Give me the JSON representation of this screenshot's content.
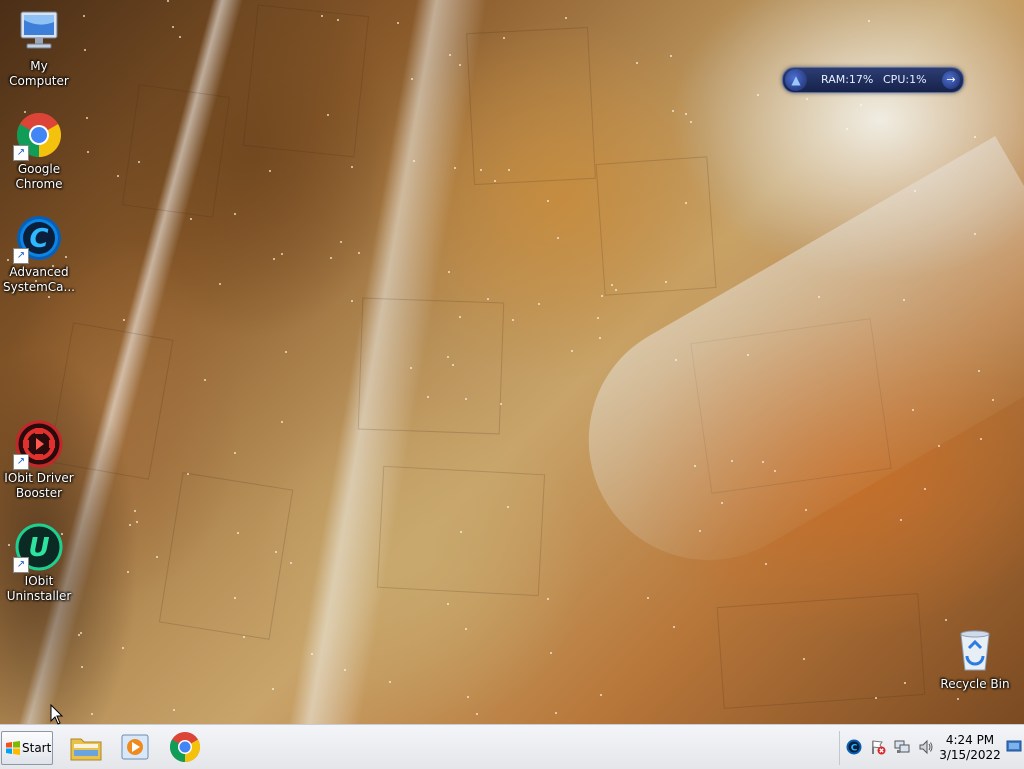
{
  "desktop": {
    "icons": [
      {
        "id": "my-computer",
        "label": "My Computer",
        "icon": "computer-icon",
        "shortcut": false
      },
      {
        "id": "google-chrome",
        "label": "Google Chrome",
        "icon": "chrome-icon",
        "shortcut": true
      },
      {
        "id": "advanced-systemcare",
        "label": "Advanced SystemCa...",
        "icon": "advanced-systemcare-icon",
        "shortcut": true
      },
      {
        "id": "iobit-driver-booster",
        "label": "IObit Driver Booster",
        "icon": "driver-booster-icon",
        "shortcut": true
      },
      {
        "id": "iobit-uninstaller",
        "label": "IObit Uninstaller",
        "icon": "iobit-uninstaller-icon",
        "shortcut": true
      },
      {
        "id": "recycle-bin",
        "label": "Recycle Bin",
        "icon": "recycle-bin-icon",
        "shortcut": false
      }
    ]
  },
  "sysmon": {
    "ram_label": "RAM:17%",
    "cpu_label": "CPU:1%",
    "ram_percent": 17,
    "cpu_percent": 1
  },
  "taskbar": {
    "start_label": "Start",
    "pinned": [
      {
        "name": "file-explorer",
        "icon": "folder-icon"
      },
      {
        "name": "media-player",
        "icon": "media-player-icon"
      },
      {
        "name": "google-chrome",
        "icon": "chrome-icon"
      }
    ],
    "tray_icons": [
      "advanced-systemcare-tray-icon",
      "action-center-flag-icon",
      "network-icon",
      "volume-icon"
    ],
    "clock": {
      "time": "4:24 PM",
      "date": "3/15/2022"
    }
  },
  "colors": {
    "taskbar_bg": "#eceef2",
    "sysmon_bg": "#1f2d5c",
    "chrome_red": "#db4437",
    "chrome_yellow": "#f4c20d",
    "chrome_green": "#0f9d58",
    "chrome_blue": "#4285f4"
  }
}
